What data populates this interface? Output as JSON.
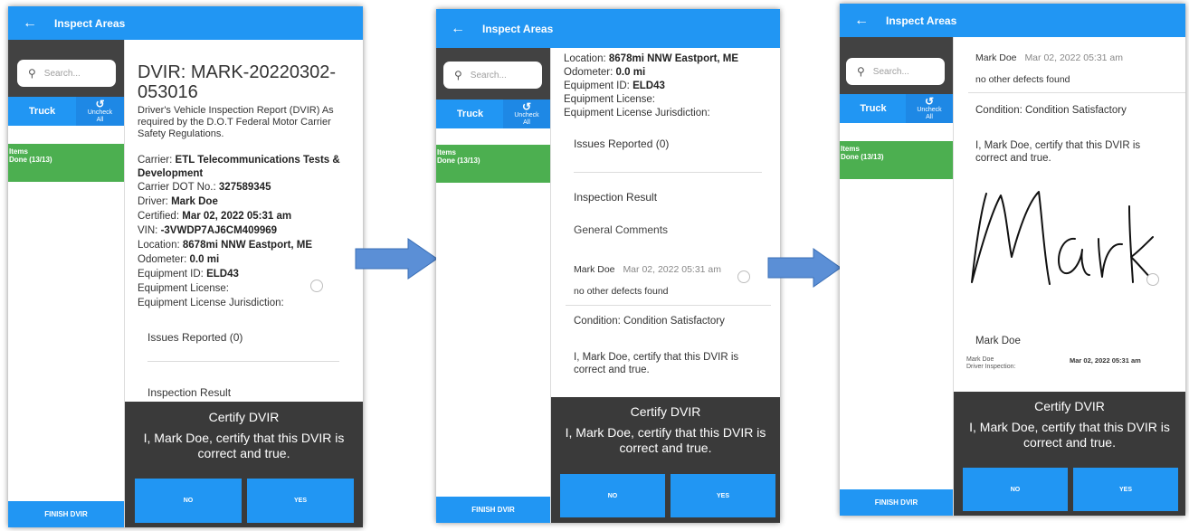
{
  "app": {
    "title": "Inspect Areas",
    "back_icon": "arrow-left-icon",
    "primary_color": "#2196f3",
    "success_color": "#4caf50",
    "dialog_color": "#3a3a3a"
  },
  "sidebar": {
    "search_placeholder": "Search...",
    "truck_label": "Truck",
    "uncheck_line1": "Uncheck",
    "uncheck_line2": "All",
    "items_label": "Items",
    "items_status": "Done (13/13)",
    "finish_label": "FINISH DVIR"
  },
  "report": {
    "title_line1": "DVIR: MARK-20220302-",
    "title_line2": "053016",
    "description": "Driver's Vehicle Inspection Report (DVIR) As required by the D.O.T Federal Motor Carrier Safety Regulations.",
    "carrier_label": "Carrier:",
    "carrier_value": "ETL Telecommunications Tests & Development",
    "dot_label": "Carrier DOT No.:",
    "dot_value": "327589345",
    "driver_label": "Driver:",
    "driver_value": "Mark Doe",
    "certified_label": "Certified:",
    "certified_value": "Mar 02, 2022  05:31 am",
    "vin_label": "VIN:",
    "vin_value": "-3VWDP7AJ6CM409969",
    "location_label": "Location:",
    "location_value": "8678mi NNW Eastport, ME",
    "odometer_label": "Odometer:",
    "odometer_value": "0.0 mi",
    "equipment_id_label": "Equipment ID:",
    "equipment_id_value": "ELD43",
    "equipment_license_label": "Equipment License:",
    "equipment_jurisdiction_label": "Equipment License Jurisdiction:",
    "issues_label": "Issues Reported (0)",
    "inspection_result_label": "Inspection Result",
    "general_comments_label": "General Comments",
    "comment_author": "Mark Doe",
    "comment_date": "Mar 02, 2022  05:31 am",
    "comment_text": "no other defects found",
    "condition_label": "Condition: Condition Satisfactory",
    "certify_statement": "I, Mark Doe, certify that this DVIR is correct and true.",
    "signature_text": "Mark",
    "signer_name": "Mark Doe",
    "signer_small_name": "Mark Doe",
    "signer_role": "Driver Inspection:",
    "signer_date": "Mar 02, 2022  05:31 am"
  },
  "dialog": {
    "title": "Certify DVIR",
    "message": "I, Mark Doe, certify that this DVIR is correct and true.",
    "no_label": "NO",
    "yes_label": "YES"
  },
  "arrow_color": "#5b8fd6"
}
